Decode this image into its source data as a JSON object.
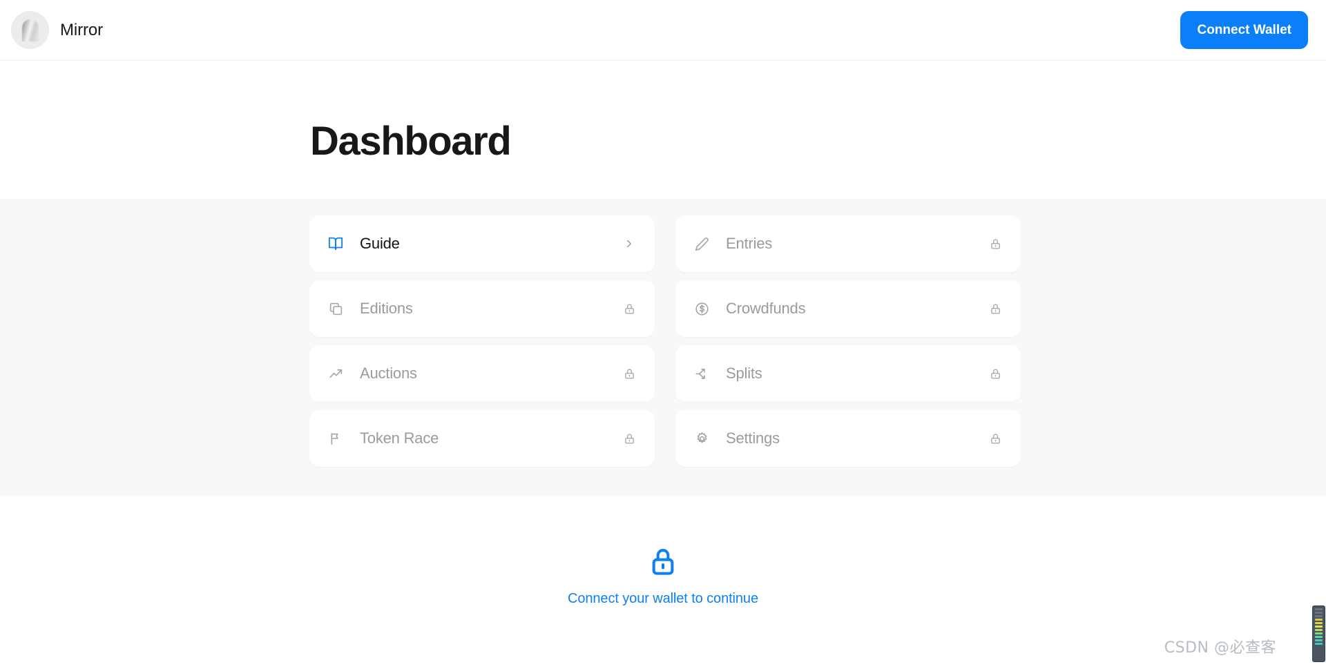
{
  "header": {
    "brand_name": "Mirror",
    "avatar_icon": "mirror-logo-avatar",
    "connect_wallet_label": "Connect Wallet",
    "accent_color": "#0b7ff7"
  },
  "main": {
    "page_title": "Dashboard"
  },
  "cards": [
    {
      "label": "Guide",
      "icon": "book-open-icon",
      "trailing_icon": "chevron-right-icon",
      "state": "active",
      "locked": false
    },
    {
      "label": "Entries",
      "icon": "pencil-icon",
      "trailing_icon": "lock-icon",
      "state": "locked",
      "locked": true
    },
    {
      "label": "Editions",
      "icon": "copy-layers-icon",
      "trailing_icon": "lock-icon",
      "state": "locked",
      "locked": true
    },
    {
      "label": "Crowdfunds",
      "icon": "dollar-circle-icon",
      "trailing_icon": "lock-icon",
      "state": "locked",
      "locked": true
    },
    {
      "label": "Auctions",
      "icon": "trending-up-icon",
      "trailing_icon": "lock-icon",
      "state": "locked",
      "locked": true
    },
    {
      "label": "Splits",
      "icon": "split-arrows-icon",
      "trailing_icon": "lock-icon",
      "state": "locked",
      "locked": true
    },
    {
      "label": "Token Race",
      "icon": "flag-icon",
      "trailing_icon": "lock-icon",
      "state": "locked",
      "locked": true
    },
    {
      "label": "Settings",
      "icon": "gear-icon",
      "trailing_icon": "lock-icon",
      "state": "locked",
      "locked": true
    }
  ],
  "gate": {
    "icon": "lock-icon",
    "message": "Connect your wallet to continue",
    "color": "#0b7ff7"
  },
  "watermark": {
    "text": "CSDN @必查客"
  }
}
